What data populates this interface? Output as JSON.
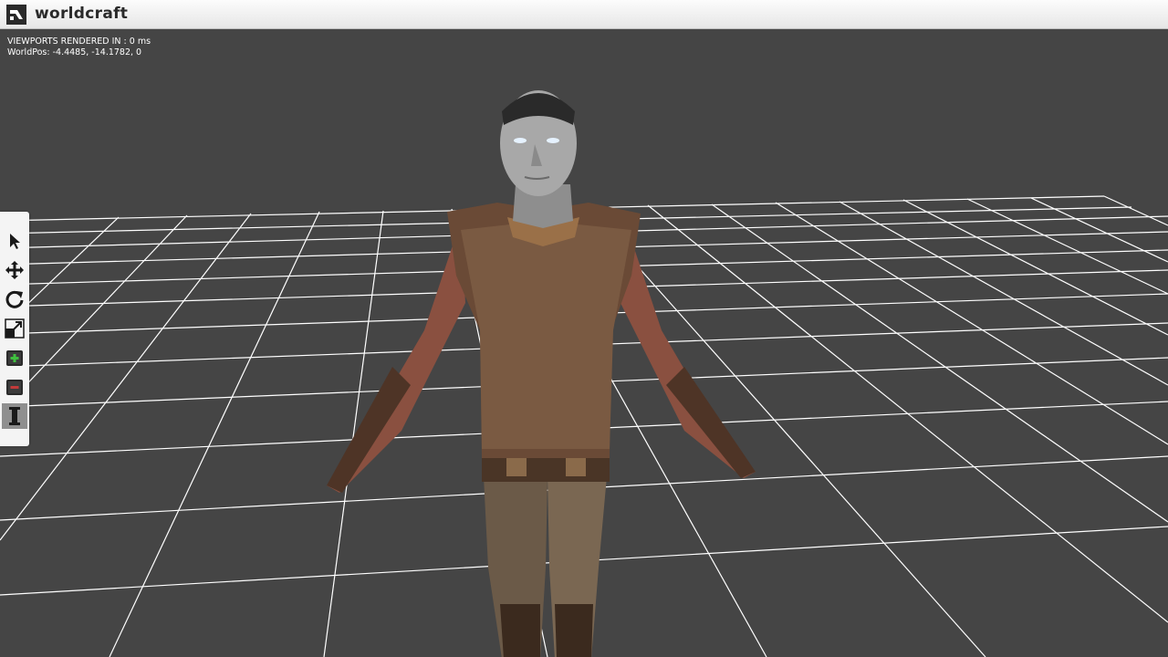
{
  "window": {
    "title": "worldcraft",
    "logo_icon": "worldcraft-logo-icon"
  },
  "viewport": {
    "stats_line1": "VIEWPORTS RENDERED IN : 0 ms",
    "stats_line2": "WorldPos: -4.4485, -14.1782, 0",
    "background_color": "#454545",
    "grid_color": "#ffffff"
  },
  "toolbar": {
    "tools": [
      {
        "name": "select-tool",
        "icon": "arrow-pointer-icon"
      },
      {
        "name": "move-tool",
        "icon": "move-arrows-icon"
      },
      {
        "name": "rotate-tool",
        "icon": "rotate-icon"
      },
      {
        "name": "scale-tool",
        "icon": "scale-icon"
      },
      {
        "name": "add-object-tool",
        "icon": "add-cube-icon"
      },
      {
        "name": "remove-object-tool",
        "icon": "remove-cube-icon"
      },
      {
        "name": "column-tool",
        "icon": "column-pillar-icon",
        "active": true
      }
    ]
  }
}
